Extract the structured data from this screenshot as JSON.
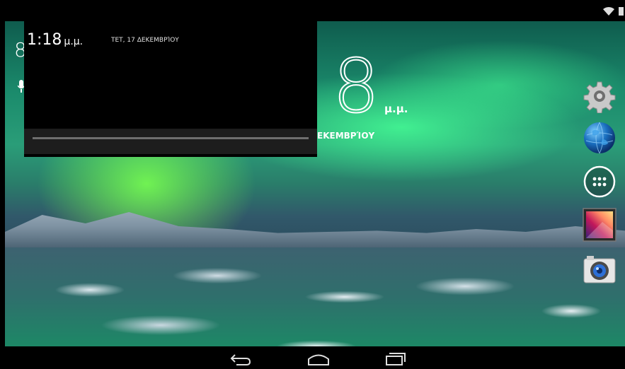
{
  "status_bar": {
    "icons": [
      "wifi-icon",
      "battery-icon"
    ]
  },
  "notification": {
    "time": "1:18",
    "ampm": "μ.μ.",
    "date": "ΤΕΤ, 17 ΔΕΚΕΜΒΡΊΟΥ"
  },
  "clock_widget": {
    "hour": "8",
    "ampm": "μ.μ.",
    "date_fragment": "ΕΚΕΜΒΡΊΟΥ"
  },
  "home_peek": {
    "digit": "8"
  },
  "dock": {
    "icons": [
      "settings-icon",
      "browser-icon",
      "apps-icon",
      "gallery-icon",
      "camera-icon"
    ]
  },
  "nav_bar": {
    "buttons": [
      "back-button",
      "home-button",
      "recent-apps-button"
    ]
  },
  "colors": {
    "accent_green": "#2a9d78",
    "panel_bg": "#000000",
    "divider": "#6e6e6e"
  }
}
